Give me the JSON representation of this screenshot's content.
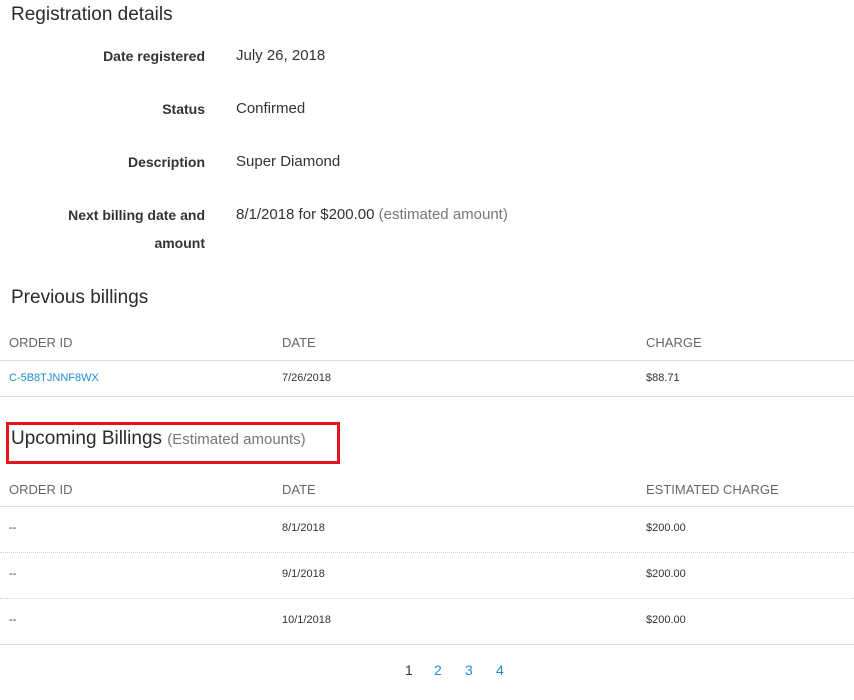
{
  "registration": {
    "title": "Registration details",
    "rows": [
      {
        "label": "Date registered",
        "value": "July 26, 2018"
      },
      {
        "label": "Status",
        "value": "Confirmed"
      },
      {
        "label": "Description",
        "value": "Super Diamond"
      },
      {
        "label_line1": "Next billing date and",
        "label_line2": "amount",
        "value": "8/1/2018 for $200.00",
        "value_note": "(estimated amount)"
      }
    ]
  },
  "previous": {
    "title": "Previous billings",
    "headers": {
      "order_id": "ORDER ID",
      "date": "DATE",
      "charge": "CHARGE"
    },
    "rows": [
      {
        "order_id": "C-5B8TJNNF8WX",
        "date": "7/26/2018",
        "charge": "$88.71"
      }
    ]
  },
  "upcoming": {
    "title": "Upcoming Billings",
    "subtitle": "(Estimated amounts)",
    "headers": {
      "order_id": "ORDER ID",
      "date": "DATE",
      "charge": "ESTIMATED CHARGE"
    },
    "rows": [
      {
        "order_id": "--",
        "date": "8/1/2018",
        "charge": "$200.00"
      },
      {
        "order_id": "--",
        "date": "9/1/2018",
        "charge": "$200.00"
      },
      {
        "order_id": "--",
        "date": "10/1/2018",
        "charge": "$200.00"
      }
    ]
  },
  "pagination": {
    "pages": [
      "1",
      "2",
      "3",
      "4"
    ],
    "current": "1"
  },
  "colors": {
    "link": "#1f8dd6",
    "highlight": "#e4151f",
    "text": "#333333",
    "muted": "#777777"
  }
}
